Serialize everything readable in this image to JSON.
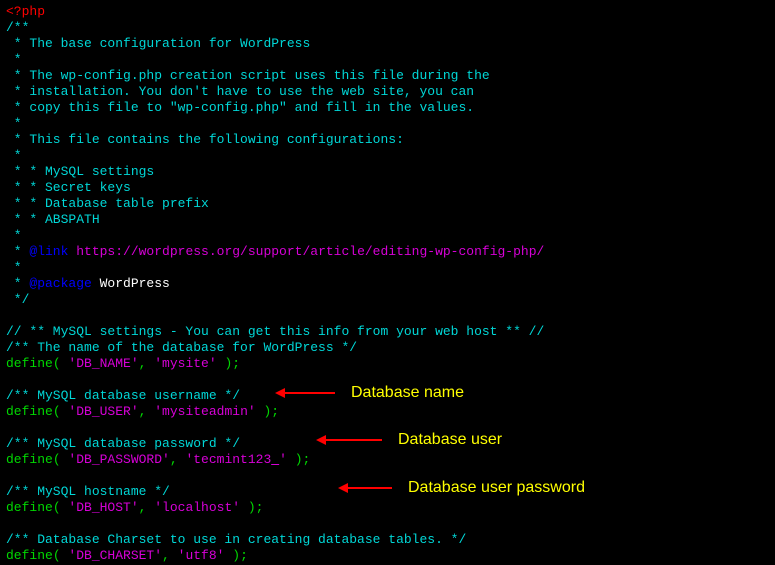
{
  "php_open": "<?php",
  "comments": {
    "block_open": "/**",
    "star": " *",
    "l1": " * The base configuration for WordPress",
    "l2": " * The wp-config.php creation script uses this file during the",
    "l3": " * installation. You don't have to use the web site, you can",
    "l4": " * copy this file to \"wp-config.php\" and fill in the values.",
    "l5": " * This file contains the following configurations:",
    "l6": " * * MySQL settings",
    "l7": " * * Secret keys",
    "l8": " * * Database table prefix",
    "l9": " * * ABSPATH",
    "link_prefix": " * ",
    "link_tag": "@link",
    "link_url": " https://wordpress.org/support/article/editing-wp-config-php/",
    "pkg_prefix": " * ",
    "pkg_tag": "@package",
    "pkg_name": " WordPress",
    "block_close": " */",
    "mysql_header": "// ** MySQL settings - You can get this info from your web host ** //",
    "db_name_c": "/** The name of the database for WordPress */",
    "db_user_c": "/** MySQL database username */",
    "db_pass_c": "/** MySQL database password */",
    "db_host_c": "/** MySQL hostname */",
    "db_charset_c": "/** Database Charset to use in creating database tables. */"
  },
  "defines": {
    "kw": "define",
    "open": "( ",
    "comma": ", ",
    "close": " );",
    "db_name_k": "'DB_NAME'",
    "db_name_v": "'mysite'",
    "db_user_k": "'DB_USER'",
    "db_user_v": "'mysiteadmin'",
    "db_pass_k": "'DB_PASSWORD'",
    "db_pass_v_pre": "'tecmint123",
    "db_pass_v_cursor": "_",
    "db_pass_v_post": "'",
    "db_host_k": "'DB_HOST'",
    "db_host_v": "'localhost'",
    "db_charset_k": "'DB_CHARSET'",
    "db_charset_v": "'utf8'"
  },
  "annotations": {
    "name": "Database name",
    "user": "Database user",
    "pass": "Database user password"
  }
}
